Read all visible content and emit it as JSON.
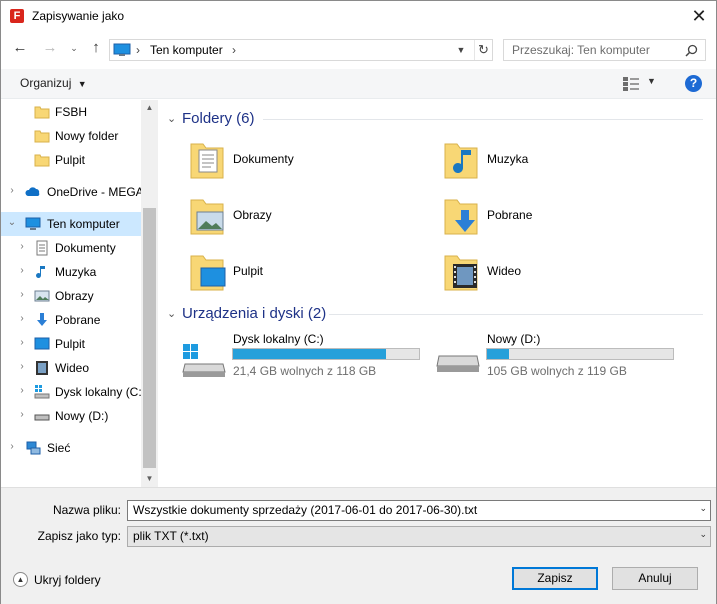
{
  "window": {
    "title": "Zapisywanie jako",
    "app_icon_letter": "F"
  },
  "address": {
    "location": "Ten komputer",
    "search_placeholder": "Przeszukaj: Ten komputer"
  },
  "toolbar": {
    "organize_label": "Organizuj"
  },
  "sidebar": {
    "items": [
      {
        "label": "FSBH",
        "icon": "folder-icon"
      },
      {
        "label": "Nowy folder",
        "icon": "folder-icon"
      },
      {
        "label": "Pulpit",
        "icon": "folder-icon"
      },
      {
        "label": "OneDrive - MEGA",
        "icon": "onedrive-icon"
      },
      {
        "label": "Ten komputer",
        "icon": "computer-icon",
        "selected": true
      },
      {
        "label": "Dokumenty",
        "icon": "documents-icon"
      },
      {
        "label": "Muzyka",
        "icon": "music-icon"
      },
      {
        "label": "Obrazy",
        "icon": "pictures-icon"
      },
      {
        "label": "Pobrane",
        "icon": "downloads-icon"
      },
      {
        "label": "Pulpit",
        "icon": "desktop-icon"
      },
      {
        "label": "Wideo",
        "icon": "video-icon"
      },
      {
        "label": "Dysk lokalny (C:)",
        "icon": "local-disk-icon"
      },
      {
        "label": "Nowy (D:)",
        "icon": "drive-icon"
      },
      {
        "label": "Sieć",
        "icon": "network-icon"
      }
    ]
  },
  "main": {
    "folders_group": "Foldery (6)",
    "folders": [
      {
        "label": "Dokumenty",
        "icon": "documents-folder-icon"
      },
      {
        "label": "Muzyka",
        "icon": "music-folder-icon"
      },
      {
        "label": "Obrazy",
        "icon": "pictures-folder-icon"
      },
      {
        "label": "Pobrane",
        "icon": "downloads-folder-icon"
      },
      {
        "label": "Pulpit",
        "icon": "desktop-folder-icon"
      },
      {
        "label": "Wideo",
        "icon": "video-folder-icon"
      }
    ],
    "drives_group": "Urządzenia i dyski (2)",
    "drives": [
      {
        "label": "Dysk lokalny (C:)",
        "free": "21,4 GB wolnych z 118 GB",
        "used_fraction": 0.82,
        "icon": "windows-drive-icon"
      },
      {
        "label": "Nowy (D:)",
        "free": "105 GB wolnych z 119 GB",
        "used_fraction": 0.12,
        "icon": "drive-icon"
      }
    ]
  },
  "form": {
    "filename_label": "Nazwa pliku:",
    "filename_value": "Wszystkie dokumenty sprzedaży (2017-06-01 do 2017-06-30).txt",
    "type_label": "Zapisz jako typ:",
    "type_value": "plik TXT (*.txt)",
    "hide_folders": "Ukryj foldery",
    "save_button": "Zapisz",
    "cancel_button": "Anuluj"
  },
  "colors": {
    "selection": "#cce8ff",
    "progress": "#26a0da",
    "group_heading": "#1e3287",
    "accent": "#0078d7"
  }
}
